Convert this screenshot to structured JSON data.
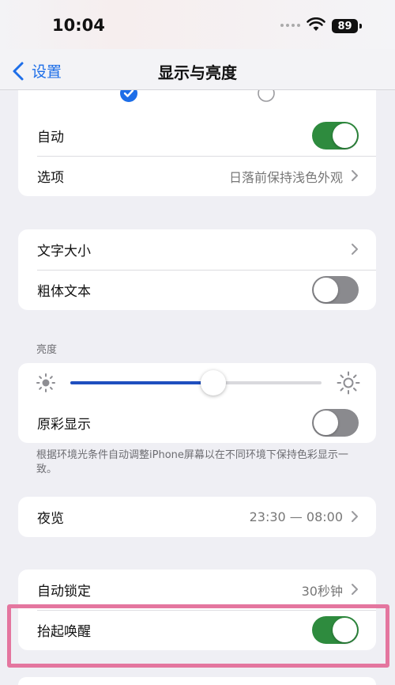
{
  "status_bar": {
    "time": "10:04",
    "battery": "89"
  },
  "nav": {
    "back_label": "设置",
    "title": "显示与亮度"
  },
  "appearance": {
    "auto_label": "自动",
    "auto_on": true,
    "options_label": "选项",
    "options_value": "日落前保持浅色外观"
  },
  "text": {
    "text_size_label": "文字大小",
    "bold_text_label": "粗体文本",
    "bold_text_on": false
  },
  "brightness": {
    "header": "亮度",
    "level": 0.57,
    "true_tone_label": "原彩显示",
    "true_tone_on": false,
    "caption": "根据环境光条件自动调整iPhone屏幕以在不同环境下保持色彩显示一致。"
  },
  "night_shift": {
    "label": "夜览",
    "value": "23:30 — 08:00"
  },
  "lock": {
    "auto_lock_label": "自动锁定",
    "auto_lock_value": "30秒钟",
    "raise_to_wake_label": "抬起唤醒",
    "raise_to_wake_on": true
  },
  "colors": {
    "accent": "#1d6ee8",
    "toggle_on": "#2e8b3e",
    "highlight": "#e4769f"
  }
}
